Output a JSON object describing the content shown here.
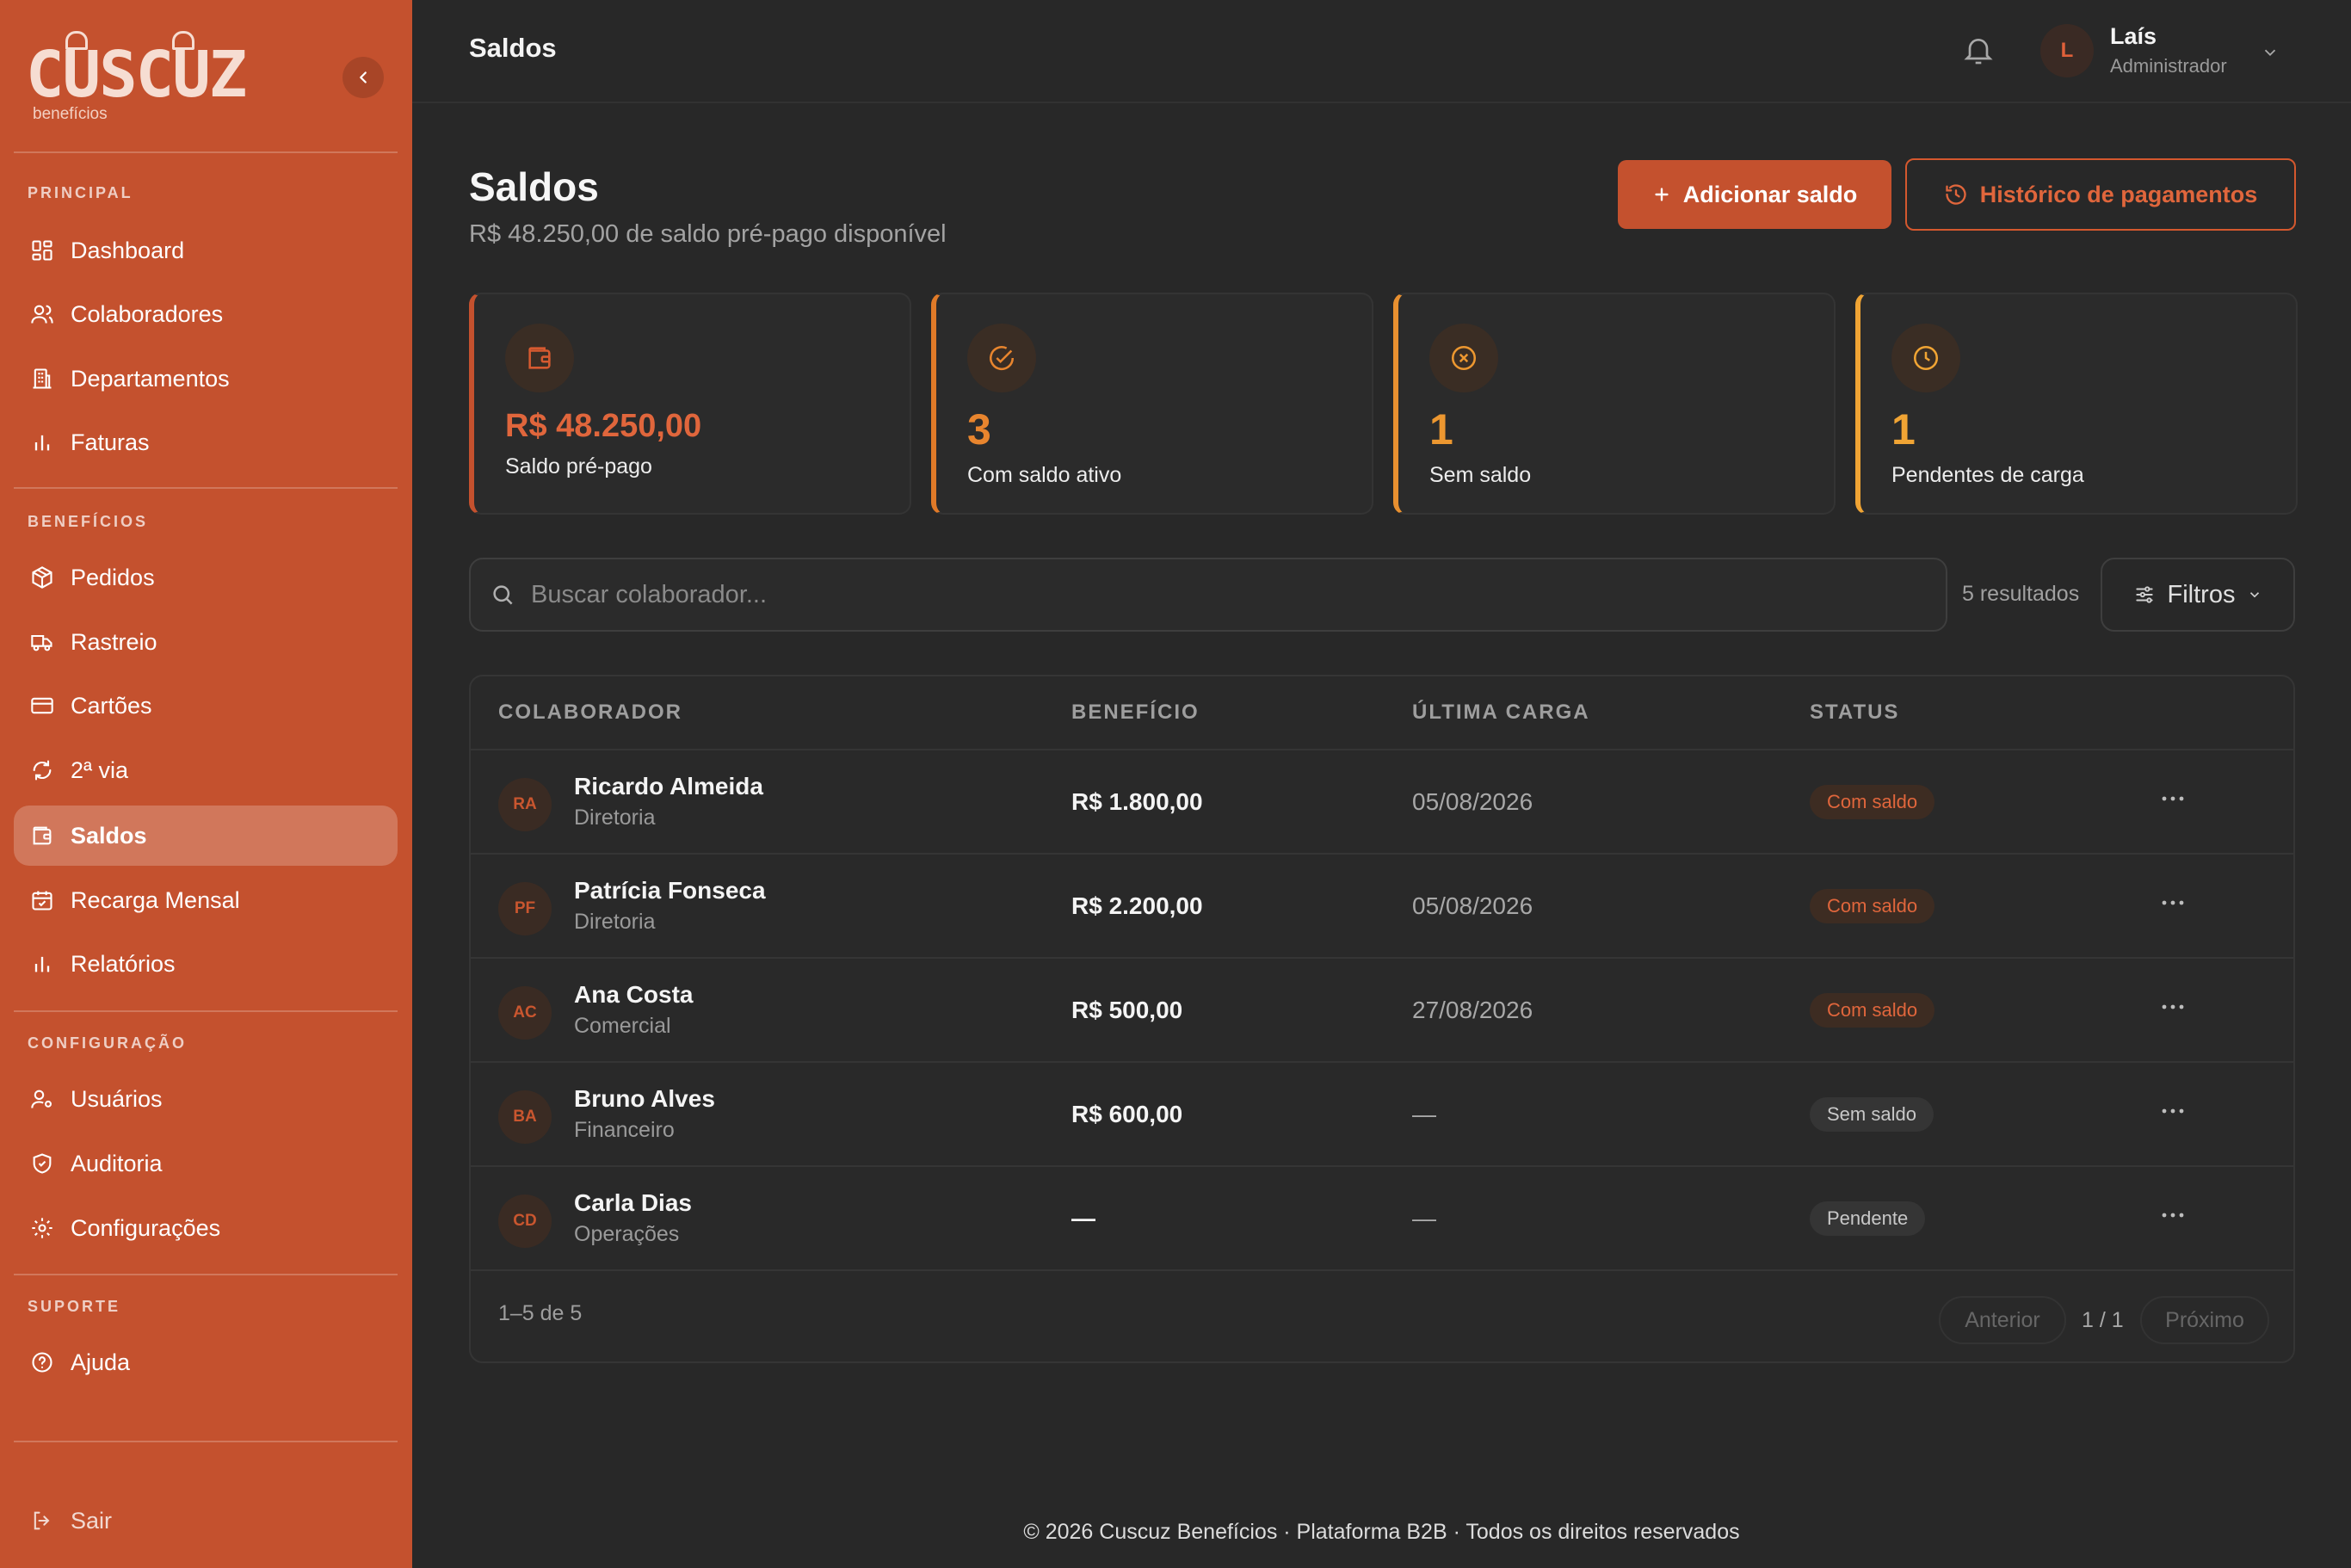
{
  "brand": {
    "logo_text": "CUSCUZ",
    "logo_sub": "benefícios",
    "primary": "#c4512e",
    "accent": "#e0663c",
    "amber": "#f0a434"
  },
  "sidebar": {
    "sections": {
      "principal": "PRINCIPAL",
      "beneficios": "BENEFÍCIOS",
      "configuracao": "CONFIGURAÇÃO",
      "suporte": "SUPORTE"
    },
    "items": [
      {
        "label": "Dashboard",
        "icon": "dashboard-icon"
      },
      {
        "label": "Colaboradores",
        "icon": "users-icon"
      },
      {
        "label": "Departamentos",
        "icon": "building-icon"
      },
      {
        "label": "Faturas",
        "icon": "bar-chart-icon"
      },
      {
        "label": "Pedidos",
        "icon": "package-icon"
      },
      {
        "label": "Rastreio",
        "icon": "truck-icon"
      },
      {
        "label": "Cartões",
        "icon": "card-icon"
      },
      {
        "label": "2ª via",
        "icon": "refresh-icon"
      },
      {
        "label": "Saldos",
        "icon": "wallet-icon"
      },
      {
        "label": "Recarga Mensal",
        "icon": "calendar-icon"
      },
      {
        "label": "Relatórios",
        "icon": "bar-chart-icon"
      },
      {
        "label": "Usuários",
        "icon": "user-key-icon"
      },
      {
        "label": "Auditoria",
        "icon": "shield-check-icon"
      },
      {
        "label": "Configurações",
        "icon": "gear-icon"
      },
      {
        "label": "Ajuda",
        "icon": "help-icon"
      }
    ],
    "active": "Saldos",
    "logout": "Sair"
  },
  "topbar": {
    "title": "Saldos",
    "user": {
      "initial": "L",
      "name": "Laís",
      "role": "Administrador"
    }
  },
  "page": {
    "title": "Saldos",
    "subtitle": "R$ 48.250,00 de saldo pré-pago disponível",
    "add_button": "Adicionar saldo",
    "history_button": "Histórico de pagamentos"
  },
  "stats": [
    {
      "value": "R$ 48.250,00",
      "label": "Saldo pré-pago",
      "icon": "wallet-icon",
      "color": "#e0663c",
      "border": "#c4512e"
    },
    {
      "value": "3",
      "label": "Com saldo ativo",
      "icon": "check-circle-icon",
      "color": "#e8852e",
      "border": "#e07a28"
    },
    {
      "value": "1",
      "label": "Sem saldo",
      "icon": "x-circle-icon",
      "color": "#ec9730",
      "border": "#e89030"
    },
    {
      "value": "1",
      "label": "Pendentes de carga",
      "icon": "clock-icon",
      "color": "#f0a434",
      "border": "#f0a434"
    }
  ],
  "search": {
    "placeholder": "Buscar colaborador...",
    "results": "5 resultados",
    "filters": "Filtros"
  },
  "table": {
    "columns": [
      "COLABORADOR",
      "BENEFÍCIO",
      "ÚLTIMA CARGA",
      "STATUS"
    ],
    "rows": [
      {
        "initials": "RA",
        "name": "Ricardo Almeida",
        "dept": "Diretoria",
        "benefit": "R$ 1.800,00",
        "last": "05/08/2026",
        "status": "Com saldo",
        "status_kind": "ok"
      },
      {
        "initials": "PF",
        "name": "Patrícia Fonseca",
        "dept": "Diretoria",
        "benefit": "R$ 2.200,00",
        "last": "05/08/2026",
        "status": "Com saldo",
        "status_kind": "ok"
      },
      {
        "initials": "AC",
        "name": "Ana Costa",
        "dept": "Comercial",
        "benefit": "R$ 500,00",
        "last": "27/08/2026",
        "status": "Com saldo",
        "status_kind": "ok"
      },
      {
        "initials": "BA",
        "name": "Bruno Alves",
        "dept": "Financeiro",
        "benefit": "R$ 600,00",
        "last": "—",
        "status": "Sem saldo",
        "status_kind": "neutral"
      },
      {
        "initials": "CD",
        "name": "Carla Dias",
        "dept": "Operações",
        "benefit": "—",
        "last": "—",
        "status": "Pendente",
        "status_kind": "neutral"
      }
    ],
    "range": "1–5 de 5",
    "prev": "Anterior",
    "page": "1 / 1",
    "next": "Próximo"
  },
  "footer": "© 2026 Cuscuz Benefícios · Plataforma B2B · Todos os direitos reservados"
}
